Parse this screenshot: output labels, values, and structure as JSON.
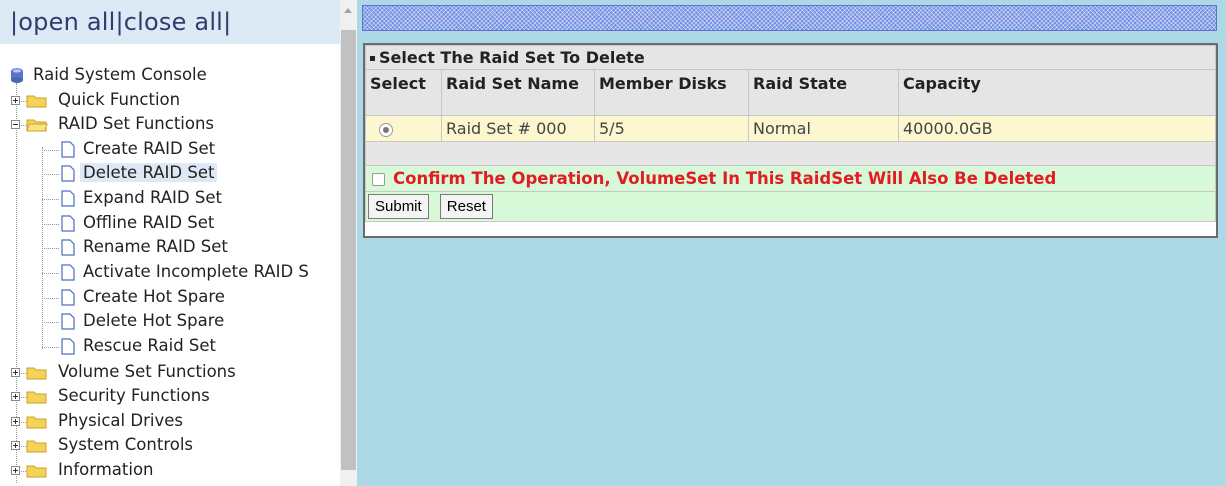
{
  "tree_header": {
    "open_all": "open all",
    "close_all": "close all",
    "separator": "|"
  },
  "tree": {
    "root": "Raid System Console",
    "items": [
      {
        "label": "Quick Function",
        "type": "folder",
        "state": "collapsed"
      },
      {
        "label": "RAID Set Functions",
        "type": "folder",
        "state": "expanded",
        "children": [
          {
            "label": "Create RAID Set"
          },
          {
            "label": "Delete RAID Set",
            "selected": true
          },
          {
            "label": "Expand RAID Set"
          },
          {
            "label": "Offline RAID Set"
          },
          {
            "label": "Rename RAID Set"
          },
          {
            "label": "Activate Incomplete RAID S"
          },
          {
            "label": "Create Hot Spare"
          },
          {
            "label": "Delete Hot Spare"
          },
          {
            "label": "Rescue Raid Set"
          }
        ]
      },
      {
        "label": "Volume Set Functions",
        "type": "folder",
        "state": "collapsed"
      },
      {
        "label": "Security Functions",
        "type": "folder",
        "state": "collapsed"
      },
      {
        "label": "Physical Drives",
        "type": "folder",
        "state": "collapsed"
      },
      {
        "label": "System Controls",
        "type": "folder",
        "state": "collapsed"
      },
      {
        "label": "Information",
        "type": "folder",
        "state": "collapsed"
      }
    ]
  },
  "main": {
    "section_title": "Select The Raid Set To Delete",
    "columns": [
      "Select",
      "Raid Set Name",
      "Member Disks",
      "Raid State",
      "Capacity"
    ],
    "rows": [
      {
        "selected": true,
        "name": "Raid Set # 000",
        "member_disks": "5/5",
        "state": "Normal",
        "capacity": "40000.0GB"
      }
    ],
    "confirm_label": "Confirm The Operation, VolumeSet In This RaidSet Will Also Be Deleted",
    "confirm_checked": false,
    "submit_label": "Submit",
    "reset_label": "Reset"
  },
  "colors": {
    "accent": "#6f8de3",
    "content_bg": "#add8e6",
    "warning_text": "#e31b23",
    "selected_row_bg": "#fdf7cf",
    "confirm_bg": "#d7f9d7"
  },
  "icons": {
    "root": "raid-console-icon",
    "folder": "folder-icon",
    "document": "document-icon",
    "expand": "plus-box-icon",
    "collapse": "minus-box-icon"
  }
}
